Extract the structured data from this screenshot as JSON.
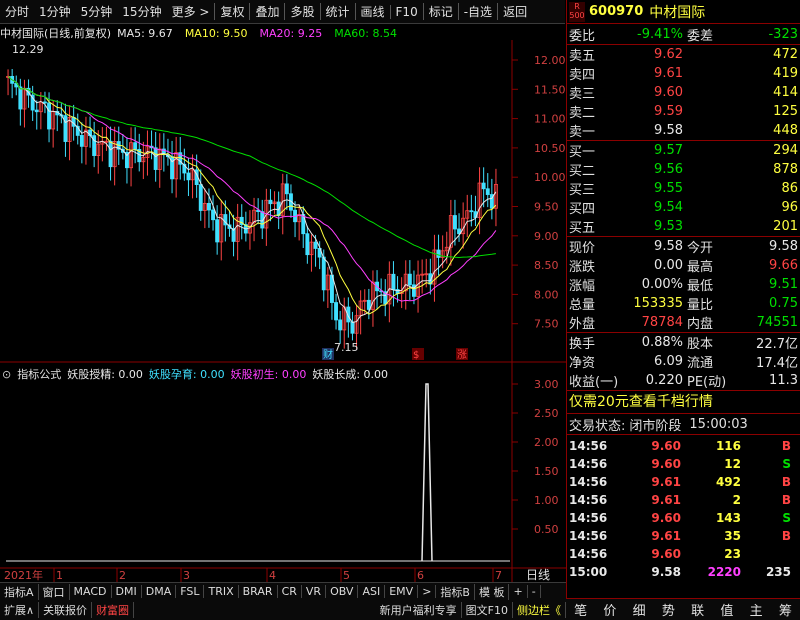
{
  "toolbar": {
    "items": [
      "分时",
      "1分钟",
      "5分钟",
      "15分钟",
      "更多 >",
      "复权",
      "叠加",
      "多股",
      "统计",
      "画线",
      "F10",
      "标记",
      "-自选",
      "返回"
    ]
  },
  "chart": {
    "title": "中材国际(日线,前复权)",
    "ma": [
      {
        "label": "MA5: 9.67",
        "color": "#e8e8e8"
      },
      {
        "label": "MA10: 9.50",
        "color": "#ffff40"
      },
      {
        "label": "MA20: 9.25",
        "color": "#ff40ff"
      },
      {
        "label": "MA60: 8.54",
        "color": "#00e000"
      }
    ],
    "high_label": "12.29",
    "low_label": "7.15",
    "y_ticks": [
      "12.00",
      "11.50",
      "11.00",
      "10.50",
      "10.00",
      "9.50",
      "9.00",
      "8.50",
      "8.00",
      "7.50"
    ],
    "markers": [
      "财",
      "$",
      "涨"
    ]
  },
  "indicator": {
    "title": "指标公式",
    "items": [
      {
        "label": "妖股授精: 0.00",
        "color": "#e8e8e8"
      },
      {
        "label": "妖股孕育: 0.00",
        "color": "#40e0ff"
      },
      {
        "label": "妖股初生: 0.00",
        "color": "#ff40ff"
      },
      {
        "label": "妖股长成: 0.00",
        "color": "#e8e8e8"
      }
    ],
    "y_ticks": [
      "3.00",
      "2.50",
      "2.00",
      "1.50",
      "1.00",
      "0.50"
    ]
  },
  "timeaxis": {
    "labels": [
      "2021年",
      "1",
      "2",
      "3",
      "4",
      "5",
      "6",
      "7"
    ],
    "period": "日线"
  },
  "bottom_tabs": [
    "指标A",
    "窗口",
    "MACD",
    "DMI",
    "DMA",
    "FSL",
    "TRIX",
    "BRAR",
    "CR",
    "VR",
    "OBV",
    "ASI",
    "EMV",
    ">",
    "指标B",
    "模 板",
    "+",
    "-"
  ],
  "status_tabs": [
    "扩展∧",
    "关联报价",
    "财富圈"
  ],
  "status_right": [
    "新用户福利专享",
    "图文F10",
    "侧边栏《"
  ],
  "stock": {
    "code": "600970",
    "name": "中材国际",
    "badge_top": "R",
    "badge_bottom": "500"
  },
  "order": {
    "weibi_label": "委比",
    "weibi": "-9.41%",
    "weicha_label": "委差",
    "weicha": "-323"
  },
  "asks": [
    {
      "label": "卖五",
      "price": "9.62",
      "vol": "472"
    },
    {
      "label": "卖四",
      "price": "9.61",
      "vol": "419"
    },
    {
      "label": "卖三",
      "price": "9.60",
      "vol": "414"
    },
    {
      "label": "卖二",
      "price": "9.59",
      "vol": "125"
    },
    {
      "label": "卖一",
      "price": "9.58",
      "vol": "448"
    }
  ],
  "bids": [
    {
      "label": "买一",
      "price": "9.57",
      "vol": "294"
    },
    {
      "label": "买二",
      "price": "9.56",
      "vol": "878"
    },
    {
      "label": "买三",
      "price": "9.55",
      "vol": "86"
    },
    {
      "label": "买四",
      "price": "9.54",
      "vol": "96"
    },
    {
      "label": "买五",
      "price": "9.53",
      "vol": "201"
    }
  ],
  "quote": [
    {
      "l1": "现价",
      "v1": "9.58",
      "c1": "white",
      "l2": "今开",
      "v2": "9.58",
      "c2": "white"
    },
    {
      "l1": "涨跌",
      "v1": "0.00",
      "c1": "white",
      "l2": "最高",
      "v2": "9.66",
      "c2": "red"
    },
    {
      "l1": "涨幅",
      "v1": "0.00%",
      "c1": "white",
      "l2": "最低",
      "v2": "9.51",
      "c2": "green"
    },
    {
      "l1": "总量",
      "v1": "153335",
      "c1": "yellow",
      "l2": "量比",
      "v2": "0.75",
      "c2": "green"
    },
    {
      "l1": "外盘",
      "v1": "78784",
      "c1": "red",
      "l2": "内盘",
      "v2": "74551",
      "c2": "green"
    }
  ],
  "quote2": [
    {
      "l1": "换手",
      "v1": "0.88%",
      "l2": "股本",
      "v2": "22.7亿"
    },
    {
      "l1": "净资",
      "v1": "6.09",
      "l2": "流通",
      "v2": "17.4亿"
    },
    {
      "l1": "收益(一)",
      "v1": "0.220",
      "l2": "PE(动)",
      "v2": "11.3"
    }
  ],
  "promo": "仅需20元查看千档行情",
  "trade_state_label": "交易状态:",
  "trade_state": "闭市阶段",
  "trade_time": "15:00:03",
  "ticks": [
    {
      "t": "14:56",
      "p": "9.60",
      "v": "116",
      "s": "B",
      "sc": "red",
      "vc": "yellow"
    },
    {
      "t": "14:56",
      "p": "9.60",
      "v": "12",
      "s": "S",
      "sc": "green",
      "vc": "yellow"
    },
    {
      "t": "14:56",
      "p": "9.61",
      "v": "492",
      "s": "B",
      "sc": "red",
      "vc": "yellow"
    },
    {
      "t": "14:56",
      "p": "9.61",
      "v": "2",
      "s": "B",
      "sc": "red",
      "vc": "yellow"
    },
    {
      "t": "14:56",
      "p": "9.60",
      "v": "143",
      "s": "S",
      "sc": "green",
      "vc": "yellow"
    },
    {
      "t": "14:56",
      "p": "9.61",
      "v": "35",
      "s": "B",
      "sc": "red",
      "vc": "yellow"
    },
    {
      "t": "14:56",
      "p": "9.60",
      "v": "23",
      "s": "",
      "sc": "white",
      "vc": "yellow"
    },
    {
      "t": "15:00",
      "p": "9.58",
      "v": "2220",
      "s": "235",
      "sc": "white",
      "vc": "magenta"
    }
  ],
  "nav": [
    "笔",
    "价",
    "细",
    "势",
    "联",
    "值",
    "主",
    "筹"
  ]
}
